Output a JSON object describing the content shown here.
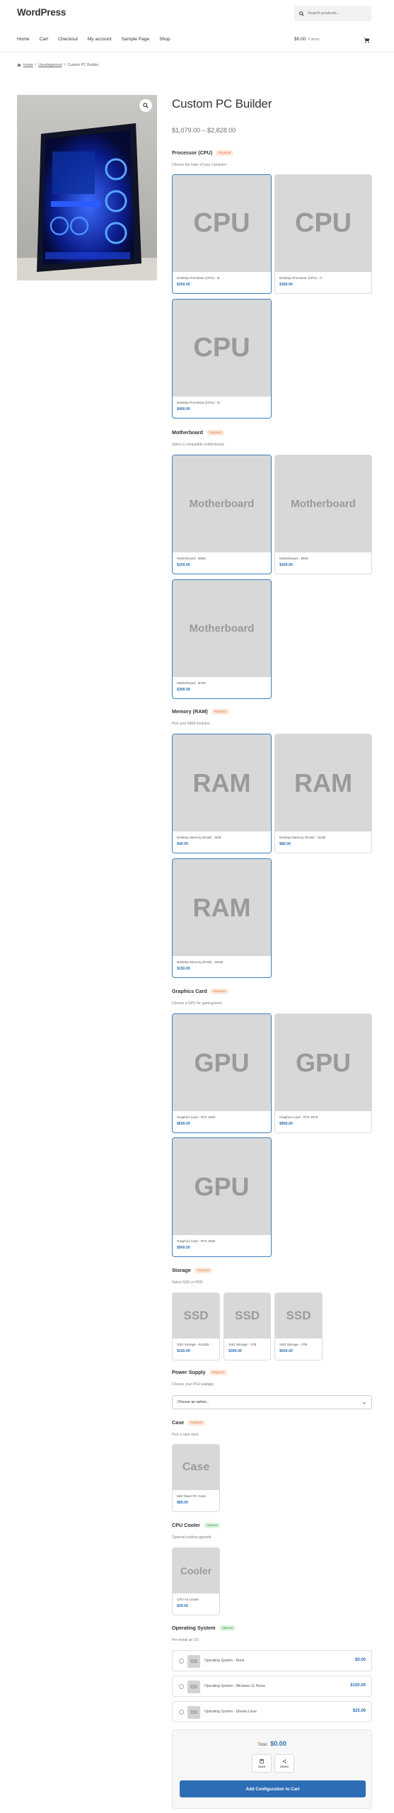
{
  "site": {
    "title": "WordPress"
  },
  "search": {
    "placeholder": "Search products..."
  },
  "nav": {
    "items": [
      "Home",
      "Cart",
      "Checkout",
      "My account",
      "Sample Page",
      "Shop"
    ]
  },
  "cart": {
    "total": "$0.00",
    "count": "0 items"
  },
  "breadcrumb": {
    "home": "Home",
    "category": "Uncategorized",
    "current": "Custom PC Builder"
  },
  "product": {
    "title": "Custom PC Builder",
    "price_range": "$1,079.00 – $2,828.00"
  },
  "sections": {
    "cpu": {
      "title": "Processor (CPU)",
      "badge": "Required",
      "desc": "Choose the brain of your computer.",
      "thumb": "CPU",
      "items": [
        {
          "name": "Desktop Processor (CPU) - i5",
          "price": "$200.00"
        },
        {
          "name": "Desktop Processor (CPU) - i7",
          "price": "$300.00"
        },
        {
          "name": "Desktop Processor (CPU) - i9",
          "price": "$400.00"
        }
      ]
    },
    "motherboard": {
      "title": "Motherboard",
      "badge": "Required",
      "desc": "Select a compatible motherboard.",
      "thumb": "Motherboard",
      "items": [
        {
          "name": "Motherboard - B660",
          "price": "$100.00"
        },
        {
          "name": "Motherboard - Z690",
          "price": "$200.00"
        },
        {
          "name": "Motherboard - B750",
          "price": "$300.00"
        }
      ]
    },
    "ram": {
      "title": "Memory (RAM)",
      "badge": "Required",
      "desc": "Pick your RAM modules.",
      "thumb": "RAM",
      "items": [
        {
          "name": "Desktop Memory (RAM) - 8GB",
          "price": "$40.00"
        },
        {
          "name": "Desktop Memory (RAM) - 16GB",
          "price": "$80.00"
        },
        {
          "name": "Desktop Memory (RAM) - 32GB",
          "price": "$150.00"
        }
      ]
    },
    "gpu": {
      "title": "Graphics Card",
      "badge": "Required",
      "desc": "Choose a GPU for gaming/work.",
      "thumb": "GPU",
      "items": [
        {
          "name": "Graphics Card - RTX 4060",
          "price": "$600.00"
        },
        {
          "name": "Graphics Card - RTX 4070",
          "price": "$800.00"
        },
        {
          "name": "Graphics Card - RTX 4080",
          "price": "$900.00"
        }
      ]
    },
    "storage": {
      "title": "Storage",
      "badge": "Required",
      "desc": "Select SSD or HDD.",
      "thumb": "SSD",
      "items": [
        {
          "name": "SSD Storage - 512GB",
          "price": "$150.00"
        },
        {
          "name": "SSD Storage - 1TB",
          "price": "$300.00"
        },
        {
          "name": "SSD Storage - 2TB",
          "price": "$500.00"
        }
      ]
    },
    "psu": {
      "title": "Power Supply",
      "badge": "Required",
      "desc": "Choose your PSU wattage.",
      "select_value": "Choose an option..."
    },
    "case": {
      "title": "Case",
      "badge": "Required",
      "desc": "Pick a case style.",
      "thumb": "Case",
      "items": [
        {
          "name": "Mid-Tower PC Case",
          "price": "$89.00"
        }
      ]
    },
    "cooler": {
      "title": "CPU Cooler",
      "badge": "Optional",
      "desc": "Optional cooling upgrade",
      "thumb": "Cooler",
      "items": [
        {
          "name": "CPU Air Cooler",
          "price": "$39.00"
        }
      ]
    },
    "os": {
      "title": "Operating System",
      "badge": "Optional",
      "desc": "Pre-install an OS",
      "thumb": "OS",
      "items": [
        {
          "name": "Operating System - None",
          "price": "$0.00"
        },
        {
          "name": "Operating System - Windows 11 Home",
          "price": "$150.00"
        },
        {
          "name": "Operating System - Ubuntu Linux",
          "price": "$25.00"
        }
      ]
    }
  },
  "summary": {
    "total_label": "Total:",
    "total_value": "$0.00",
    "save_label": "Save",
    "share_label": "Share",
    "add_to_cart": "Add Configuration to Cart"
  },
  "colors": {
    "accent": "#2c6db5",
    "selected_border": "#3c7fc0",
    "required_badge": "#e0763a",
    "optional_badge": "#3a9b4a"
  },
  "icons": [
    "search-icon",
    "cart-icon",
    "home-icon",
    "zoom-icon",
    "chevron-down-icon",
    "save-icon",
    "share-icon"
  ]
}
